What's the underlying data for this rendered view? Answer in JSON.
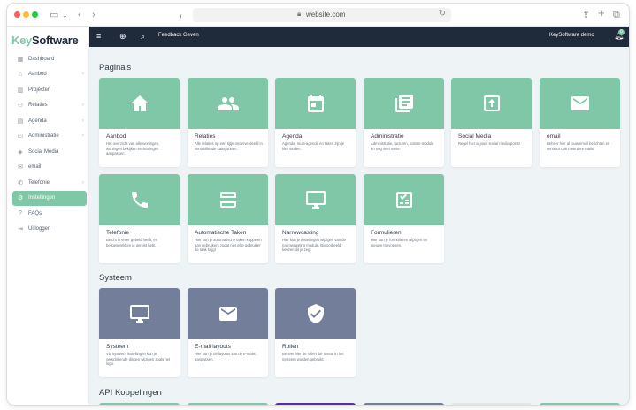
{
  "browser": {
    "url": "website.com"
  },
  "app": {
    "logo_prefix": "Key",
    "logo_suffix": "Software"
  },
  "sidebar": {
    "items": [
      {
        "label": "Dashboard",
        "icon": "grid-icon",
        "chevron": false,
        "active": false
      },
      {
        "label": "Aanbod",
        "icon": "home-icon",
        "chevron": true,
        "active": false
      },
      {
        "label": "Projecten",
        "icon": "building-icon",
        "chevron": false,
        "active": false
      },
      {
        "label": "Relaties",
        "icon": "people-icon",
        "chevron": true,
        "active": false
      },
      {
        "label": "Agenda",
        "icon": "calendar-icon",
        "chevron": true,
        "active": false
      },
      {
        "label": "Administratie",
        "icon": "document-icon",
        "chevron": true,
        "active": false
      },
      {
        "label": "Social Media",
        "icon": "share-icon",
        "chevron": false,
        "active": false
      },
      {
        "label": "email",
        "icon": "mail-icon",
        "chevron": false,
        "active": false
      },
      {
        "label": "Telefonie",
        "icon": "phone-icon",
        "chevron": true,
        "active": false
      },
      {
        "label": "Instellingen",
        "icon": "gear-icon",
        "chevron": false,
        "active": true
      },
      {
        "label": "FAQs",
        "icon": "question-icon",
        "chevron": false,
        "active": false
      },
      {
        "label": "Uitloggen",
        "icon": "logout-icon",
        "chevron": false,
        "active": false
      }
    ]
  },
  "topbar": {
    "feedback_label": "Feedback Geven",
    "user_label": "KeySoftware demo",
    "notification_count": "0"
  },
  "sections": {
    "paginas": {
      "title": "Pagina's",
      "cards": [
        {
          "title": "Aanbod",
          "desc": "Het overzicht van alle woningen, woningen bekijken en woningen aanpassen.",
          "icon": "home-icon"
        },
        {
          "title": "Relaties",
          "desc": "Alle relaties op een rijtje onderverdeeld in verschillende categorieën.",
          "icon": "people-icon"
        },
        {
          "title": "Agenda",
          "desc": "Agenda, multi-agenda en taken zijn je hier vinden.",
          "icon": "calendar-icon"
        },
        {
          "title": "Administratie",
          "desc": "Administratie, facturen, kosten-module en nog veel meer!",
          "icon": "document-icon"
        },
        {
          "title": "Social Media",
          "desc": "Regel hier al jouw social media posts!",
          "icon": "upload-icon"
        },
        {
          "title": "email",
          "desc": "Beheer hier al jouw email berichten en verstuur ook meerdere mails.",
          "icon": "mail-icon"
        },
        {
          "title": "Telefonie",
          "desc": "Belcht in en er gebeld heeft, en bellgesprekken je gemist hebt.",
          "icon": "phone-icon"
        },
        {
          "title": "Automatische Taken",
          "desc": "Hier kun je automatische taken koppelen aan gebruikers zodat niet elke gebruiker de taak krijgt",
          "icon": "split-icon"
        },
        {
          "title": "Narrowcasting",
          "desc": "Hier kun je instellingen wijzigen van de narrowcasting module. Bijvoorbeeld keuzen dit je zegt",
          "icon": "monitor-icon"
        },
        {
          "title": "Formulieren",
          "desc": "Hier kun je formulieren wijzigen en nieuwe toevoegen.",
          "icon": "checklist-icon"
        }
      ]
    },
    "systeem": {
      "title": "Systeem",
      "cards": [
        {
          "title": "Systeem",
          "desc": "Via systeem instellingen kun je verschillende dingen wijzigen zoals het logo.",
          "icon": "monitor-icon"
        },
        {
          "title": "E-mail layouts",
          "desc": "Hier kun je de layouts van de e-mails aanpassen.",
          "icon": "mail-icon"
        },
        {
          "title": "Rollen",
          "desc": "Beheer hier de rollen die overal in het systeem worden gebruikt.",
          "icon": "shield-check-icon"
        }
      ]
    },
    "api": {
      "title": "API Koppelingen"
    }
  },
  "colors": {
    "accent": "#7fc7a6",
    "topbar": "#1f2a3b",
    "slate": "#737f9a",
    "background": "#eef3f6"
  }
}
